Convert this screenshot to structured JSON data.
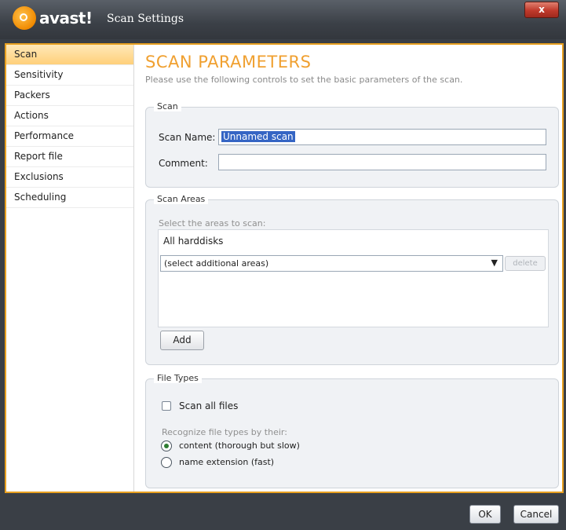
{
  "window": {
    "brand": "avast!",
    "title": "Scan Settings",
    "close_label": "x"
  },
  "sidebar": {
    "items": [
      {
        "label": "Scan",
        "active": true
      },
      {
        "label": "Sensitivity"
      },
      {
        "label": "Packers"
      },
      {
        "label": "Actions"
      },
      {
        "label": "Performance"
      },
      {
        "label": "Report file"
      },
      {
        "label": "Exclusions"
      },
      {
        "label": "Scheduling"
      }
    ]
  },
  "main": {
    "title": "SCAN PARAMETERS",
    "description": "Please use the following controls to set the basic parameters of the scan.",
    "scan_group": {
      "title": "Scan",
      "name_label": "Scan Name:",
      "name_value": "Unnamed scan",
      "comment_label": "Comment:",
      "comment_value": ""
    },
    "areas_group": {
      "title": "Scan Areas",
      "hint": "Select the areas to scan:",
      "items": [
        "All harddisks"
      ],
      "dropdown_value": "(select additional areas)",
      "delete_label": "delete",
      "add_label": "Add"
    },
    "filetypes_group": {
      "title": "File Types",
      "scan_all_label": "Scan all files",
      "scan_all_checked": false,
      "recognize_hint": "Recognize file types by their:",
      "option_content": "content (thorough but slow)",
      "option_extension": "name extension (fast)",
      "selected_option": "content"
    }
  },
  "footer": {
    "ok_label": "OK",
    "cancel_label": "Cancel"
  },
  "colors": {
    "accent": "#f0a030",
    "frame_border": "#e8a020",
    "titlebar": "#3b4047",
    "selection": "#3565c4"
  }
}
